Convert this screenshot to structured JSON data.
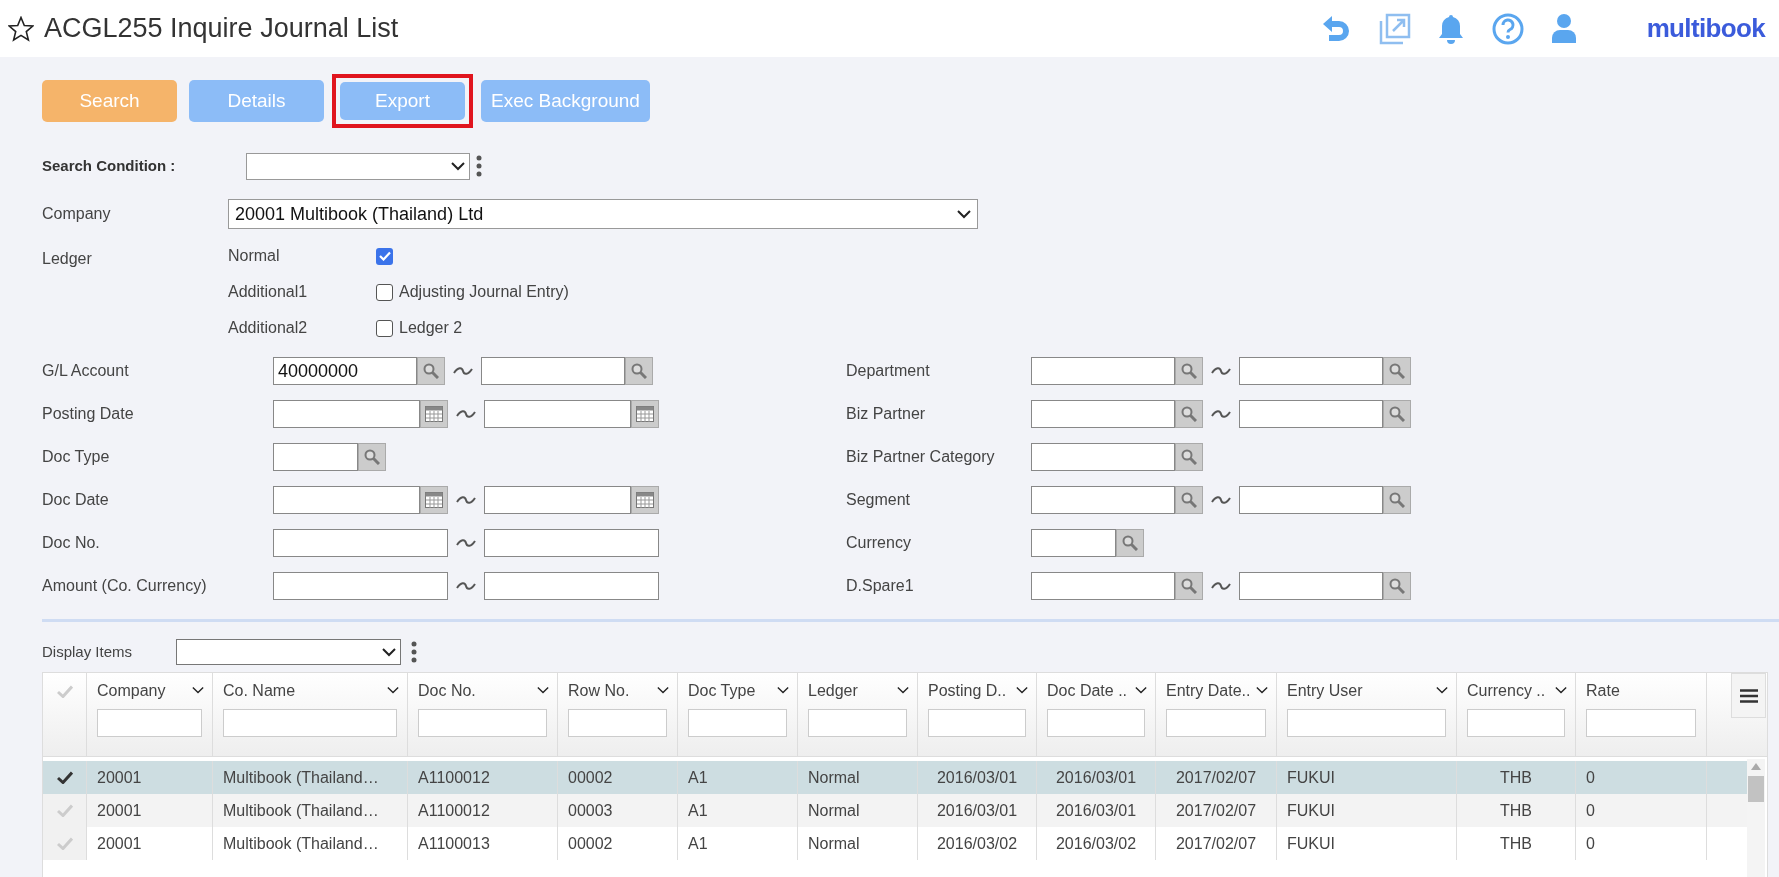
{
  "header": {
    "title": "ACGL255 Inquire Journal List",
    "favorite": false,
    "logo": "multibook"
  },
  "buttons": [
    {
      "label": "Search",
      "kind": "primary",
      "highlighted": false
    },
    {
      "label": "Details",
      "kind": "secondary",
      "highlighted": false
    },
    {
      "label": "Export",
      "kind": "secondary",
      "highlighted": true
    },
    {
      "label": "Exec Background",
      "kind": "secondary",
      "highlighted": false
    }
  ],
  "search_condition": {
    "label": "Search Condition :"
  },
  "company": {
    "label": "Company",
    "value": "20001 Multibook (Thailand) Ltd"
  },
  "ledger": {
    "label": "Ledger",
    "options": [
      {
        "label": "Normal",
        "checked": true
      },
      {
        "label": "Additional1",
        "option": "Adjusting Journal Entry)",
        "checked": false
      },
      {
        "label": "Additional2",
        "option": "Ledger 2",
        "checked": false
      }
    ]
  },
  "fields_left": [
    {
      "label": "G/L Account",
      "kind": "lookup_range",
      "from": "40000000"
    },
    {
      "label": "Posting Date",
      "kind": "date_range"
    },
    {
      "label": "Doc Type",
      "kind": "lookup_small"
    },
    {
      "label": "Doc Date",
      "kind": "date_range"
    },
    {
      "label": "Doc No.",
      "kind": "text_range"
    },
    {
      "label": "Amount (Co. Currency)",
      "kind": "text_range"
    }
  ],
  "fields_right": [
    {
      "label": "Department",
      "kind": "lookup_range"
    },
    {
      "label": "Biz Partner",
      "kind": "lookup_range"
    },
    {
      "label": "Biz Partner Category",
      "kind": "lookup"
    },
    {
      "label": "Segment",
      "kind": "lookup_range"
    },
    {
      "label": "Currency",
      "kind": "lookup_small"
    },
    {
      "label": "D.Spare1",
      "kind": "lookup_range"
    }
  ],
  "display_items": {
    "label": "Display Items"
  },
  "table": {
    "columns": [
      {
        "label": "Company",
        "sortable": true,
        "kind": "text"
      },
      {
        "label": "Co. Name",
        "sortable": true,
        "kind": "text"
      },
      {
        "label": "Doc No.",
        "sortable": true,
        "kind": "text"
      },
      {
        "label": "Row No.",
        "sortable": true,
        "kind": "text"
      },
      {
        "label": "Doc Type",
        "sortable": true,
        "kind": "text"
      },
      {
        "label": "Ledger",
        "sortable": true,
        "kind": "text"
      },
      {
        "label": "Posting D..",
        "sortable": true,
        "kind": "date"
      },
      {
        "label": "Doc Date ..",
        "sortable": true,
        "kind": "date"
      },
      {
        "label": "Entry Date..",
        "sortable": true,
        "kind": "date"
      },
      {
        "label": "Entry User",
        "sortable": true,
        "kind": "text"
      },
      {
        "label": "Currency ..",
        "sortable": true,
        "kind": "code"
      },
      {
        "label": "Rate",
        "sortable": false,
        "kind": "text"
      }
    ],
    "rows": [
      {
        "selected": true,
        "cells": [
          "20001",
          "Multibook (Thailand…",
          "A1100012",
          "00002",
          "A1",
          "Normal",
          "2016/03/01",
          "2016/03/01",
          "2017/02/07",
          "FUKUI",
          "THB",
          "0"
        ]
      },
      {
        "selected": false,
        "cells": [
          "20001",
          "Multibook (Thailand…",
          "A1100012",
          "00003",
          "A1",
          "Normal",
          "2016/03/01",
          "2016/03/01",
          "2017/02/07",
          "FUKUI",
          "THB",
          "0"
        ]
      },
      {
        "selected": false,
        "cells": [
          "20001",
          "Multibook (Thailand…",
          "A1100013",
          "00002",
          "A1",
          "Normal",
          "2016/03/02",
          "2016/03/02",
          "2017/02/07",
          "FUKUI",
          "THB",
          "0"
        ]
      }
    ]
  }
}
